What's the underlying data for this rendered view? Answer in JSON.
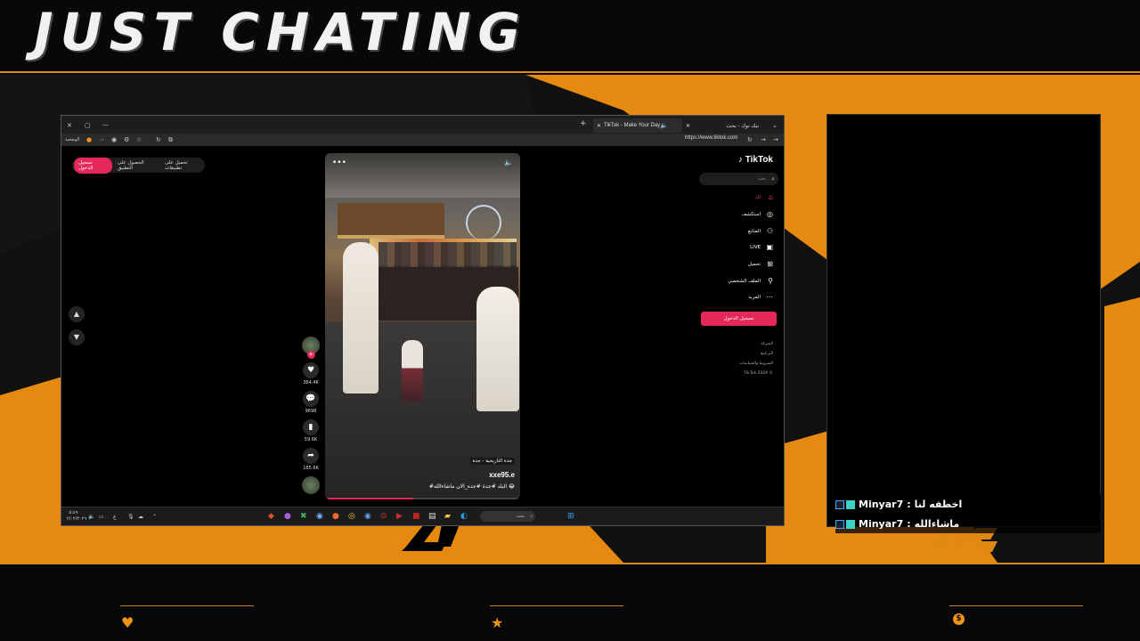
{
  "overlay": {
    "title": "JUST CHATING",
    "accent_color": "#e08a14",
    "stat_icons": [
      "heart-icon",
      "star-icon",
      "coin-icon"
    ],
    "coin_symbol": "$",
    "chat": [
      {
        "user": "Minyar7",
        "separator": ":",
        "message": "اخطفه لنا"
      },
      {
        "user": "Minyar7",
        "separator": ":",
        "message": "ماشاءالله"
      }
    ]
  },
  "browser": {
    "tabs": [
      {
        "label": "TikTok - Make Your Day",
        "active": true
      },
      {
        "label": "تيك توك - بحث",
        "active": false
      }
    ],
    "new_tab": "+",
    "url": "https://www.tiktok.com",
    "profile_label": "الوضعية"
  },
  "tiktok": {
    "logo": "TikTok",
    "search_placeholder": "بحث",
    "top_pill": {
      "login": "تسجيل الدخول",
      "get_app": "الحصول على التطبيق",
      "pc_app": "تحميل على تطبيقات"
    },
    "nav": [
      {
        "label": "لك",
        "icon": "home-icon"
      },
      {
        "label": "استكشف",
        "icon": "compass-icon"
      },
      {
        "label": "المتابع",
        "icon": "user-plus-icon"
      },
      {
        "label": "LIVE",
        "icon": "live-icon"
      },
      {
        "label": "تحميل",
        "icon": "upload-icon"
      },
      {
        "label": "الملف الشخصي",
        "icon": "profile-icon"
      },
      {
        "label": "المزيد",
        "icon": "more-icon"
      }
    ],
    "login_button": "تسجيل الدخول",
    "footer": [
      "الشركة",
      "البرنامج",
      "الشروط والسياسات",
      "TikTok 2026 ©"
    ],
    "video": {
      "location_tag": "جدة التاريخية - جدة",
      "username": "xxe95.e",
      "caption": "#البلد #جدة #جده_الان ماشاءالله 😂",
      "more": "•••",
      "progress": 0.45
    },
    "actions": [
      {
        "icon": "heart-icon",
        "count": "364.4K"
      },
      {
        "icon": "comment-icon",
        "count": "9698"
      },
      {
        "icon": "bookmark-icon",
        "count": "59.6K"
      },
      {
        "icon": "share-icon",
        "count": "185.6K"
      }
    ],
    "avatar_plus": "+",
    "nav_up": "▲",
    "nav_down": "▼"
  },
  "taskbar": {
    "search_label": "بحث",
    "clock_time": "٠٥:٤٩",
    "clock_date": "٢/٠٢/٢٠٢٦",
    "lang": "ع"
  }
}
